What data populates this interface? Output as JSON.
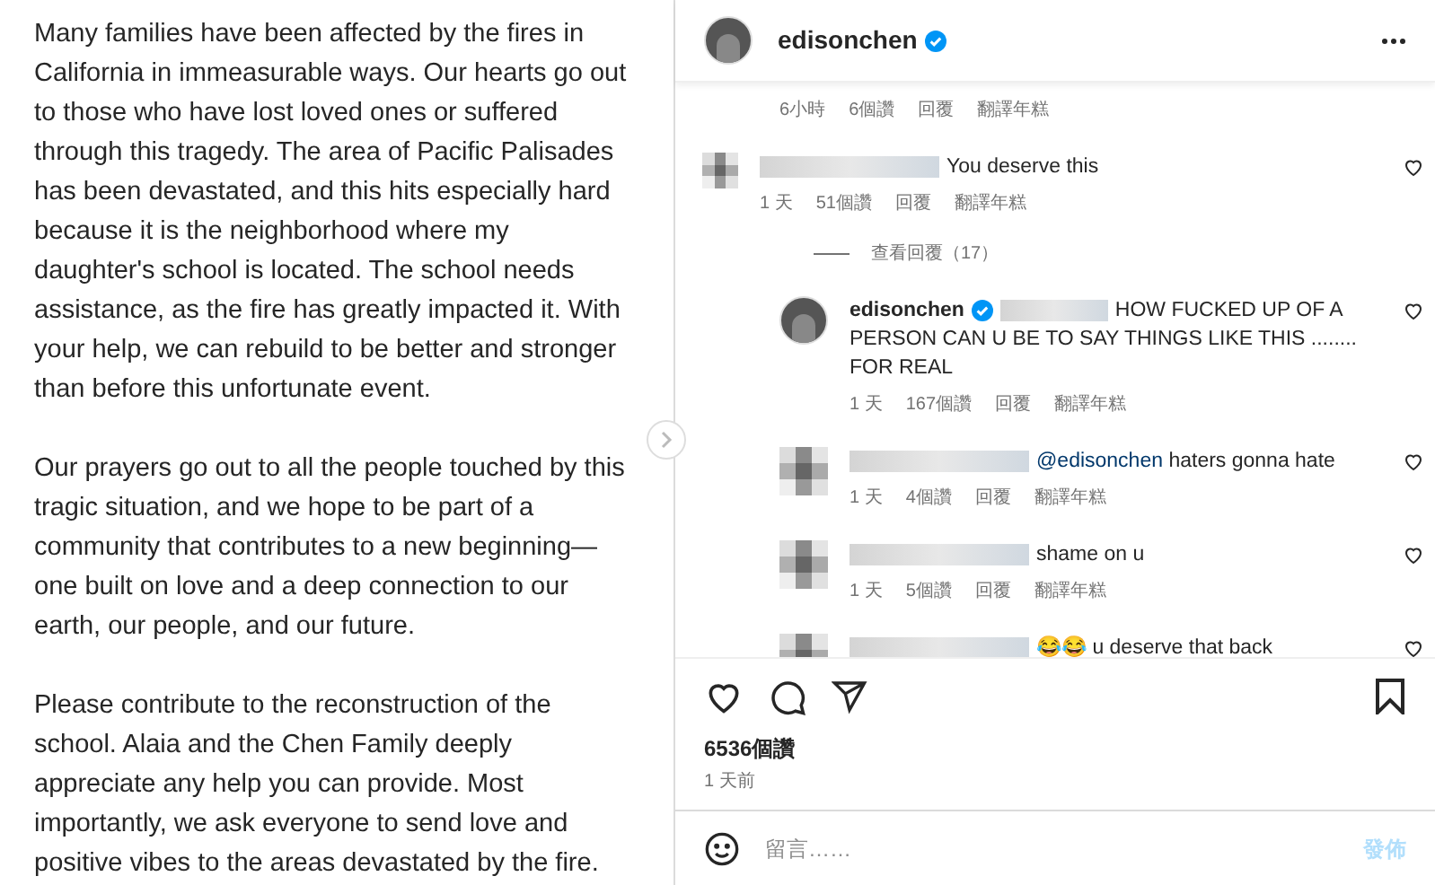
{
  "caption": {
    "paragraphs": [
      "Many families have been affected by the fires in California in immeasurable ways. Our hearts go out to those who have lost loved ones or suffered through this tragedy. The area of Pacific Palisades has been devastated, and this hits especially hard because it is the neighborhood where my daughter's school is located. The school needs assistance, as the fire has greatly impacted it. With your help, we can rebuild to be better and stronger than before this unfortunate event.",
      "Our prayers go out to all the people touched by this tragic situation, and we hope to be part of a community that contributes to a new beginning—one built on love and a deep connection to our earth, our people, and our future.",
      "Please contribute to the reconstruction of the school. Alaia and the Chen Family deeply appreciate any help you can provide. Most importantly, we ask everyone to send love and positive vibes to the areas devastated by the fire."
    ]
  },
  "header": {
    "username": "edisonchen",
    "verified": true
  },
  "top_meta": [
    "6小時",
    "6個讚",
    "回覆",
    "翻譯年糕"
  ],
  "comments": [
    {
      "kind": "comment",
      "text": "You deserve this",
      "meta": [
        "1 天",
        "51個讚",
        "回覆",
        "翻譯年糕"
      ]
    },
    {
      "kind": "view_replies",
      "text": "查看回覆（17）"
    },
    {
      "kind": "reply",
      "username": "edisonchen",
      "verified": true,
      "text": "HOW FUCKED UP OF A PERSON CAN U BE TO SAY THINGS LIKE THIS ........ FOR REAL",
      "meta": [
        "1 天",
        "167個讚",
        "回覆",
        "翻譯年糕"
      ]
    },
    {
      "kind": "reply",
      "mention": "@edisonchen",
      "text": "haters gonna hate",
      "meta": [
        "1 天",
        "4個讚",
        "回覆",
        "翻譯年糕"
      ]
    },
    {
      "kind": "reply",
      "text": "shame on u",
      "meta": [
        "1 天",
        "5個讚",
        "回覆",
        "翻譯年糕"
      ]
    },
    {
      "kind": "reply",
      "text": "😂😂 u deserve that back"
    }
  ],
  "likes": "6536個讚",
  "posted": "1 天前",
  "comment_box": {
    "placeholder": "留言……",
    "post_label": "發佈",
    "post_disabled": true
  }
}
